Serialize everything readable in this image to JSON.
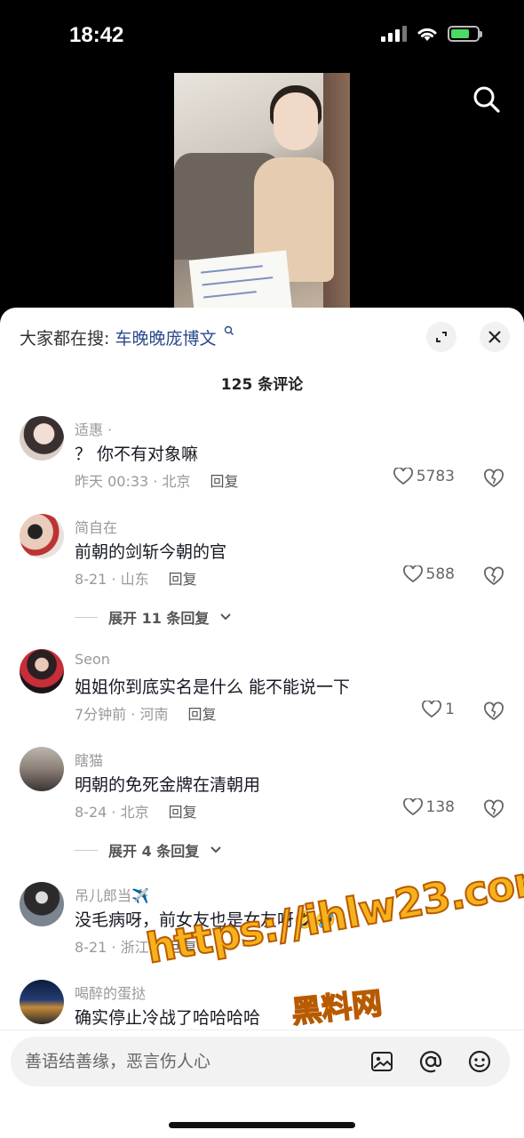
{
  "status_bar": {
    "time": "18:42"
  },
  "sheet": {
    "hot_search_label": "大家都在搜:",
    "hot_search_term": "车晚晚庞博文",
    "comment_count": "125 条评论"
  },
  "comments": [
    {
      "user": "适惠 ·",
      "text": "？ 你不有对象嘛",
      "meta": "昨天 00:33 · 北京",
      "reply": "回复",
      "likes": "5783"
    },
    {
      "user": "简自在",
      "text": "前朝的剑斩今朝的官",
      "meta": "8-21 · 山东",
      "reply": "回复",
      "likes": "588",
      "expand": "展开 11 条回复"
    },
    {
      "user": "Seon",
      "text": "姐姐你到底实名是什么 能不能说一下",
      "meta": "7分钟前 · 河南",
      "reply": "回复",
      "likes": "1"
    },
    {
      "user": "瞎猫",
      "text": "明朝的免死金牌在清朝用",
      "meta": "8-24 · 北京",
      "reply": "回复",
      "likes": "138",
      "expand": "展开 4 条回复"
    },
    {
      "user": "吊儿郎当✈️",
      "text": "没毛病呀，前女友也是女友呀🤣🤣",
      "meta": "8-21 · 浙江",
      "reply": "回复",
      "likes": ""
    },
    {
      "user": "喝醉的蛋挞",
      "text": "确实停止冷战了哈哈哈哈",
      "meta": "",
      "reply": "",
      "likes": ""
    }
  ],
  "input": {
    "placeholder": "善语结善缘，恶言伤人心"
  },
  "watermark": {
    "line1": "https://ihlw23.com",
    "line2": "黑料网"
  },
  "colors": {
    "accent_link": "#2b4a8c",
    "battery": "#4cd964",
    "watermark": "#f6b21b"
  },
  "icons": [
    "search-icon",
    "expand-icon",
    "close-icon",
    "heart-icon",
    "dislike-icon",
    "image-icon",
    "at-icon",
    "emoji-icon"
  ]
}
